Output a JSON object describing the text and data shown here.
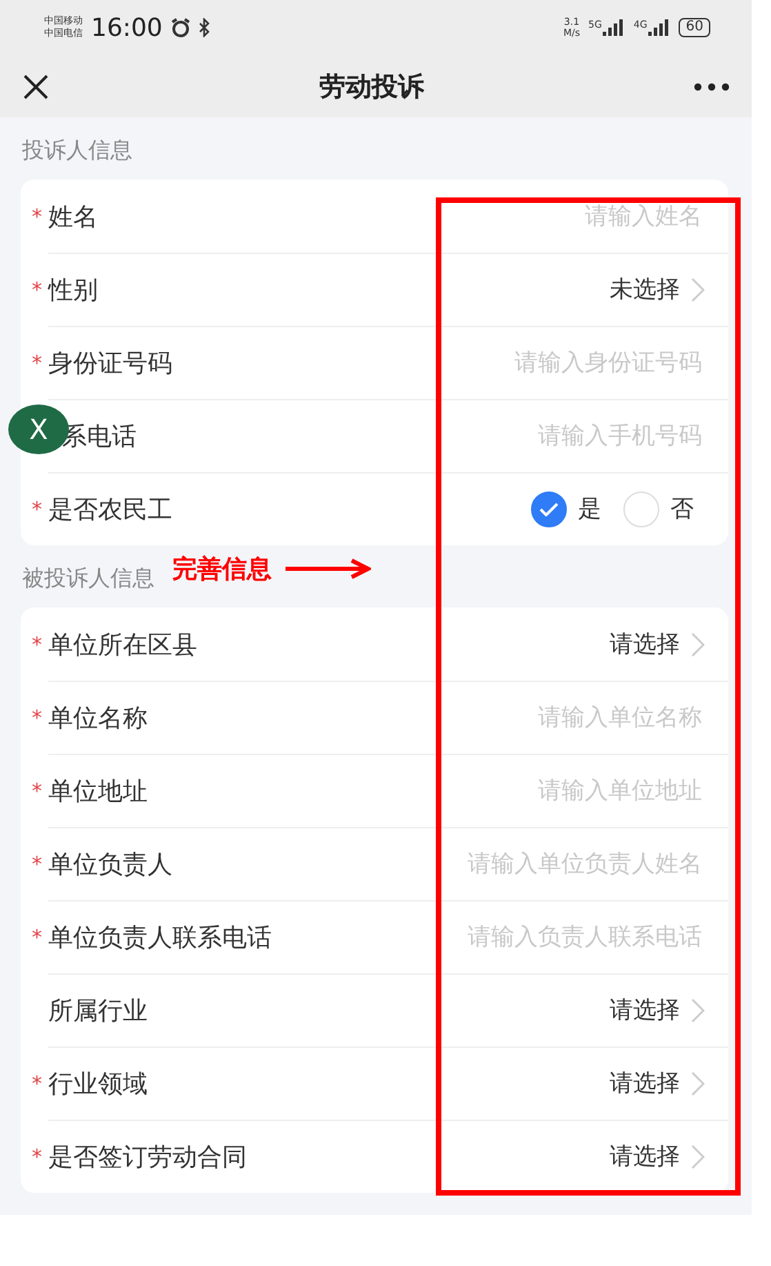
{
  "status_bar": {
    "carriers": [
      "中国移动",
      "中国电信"
    ],
    "time": "16:00",
    "speed": "3.1",
    "speed_unit": "M/s",
    "networks": [
      "5G",
      "4G"
    ],
    "battery": "60"
  },
  "nav": {
    "title": "劳动投诉"
  },
  "sections": [
    {
      "title": "投诉人信息",
      "rows": [
        {
          "kind": "input",
          "label": "姓名",
          "mark": "*",
          "placeholder": "请输入姓名"
        },
        {
          "kind": "select",
          "label": "性别",
          "mark": "*",
          "value": "未选择"
        },
        {
          "kind": "input",
          "label": "身份证号码",
          "mark": "*",
          "placeholder": "请输入身份证号码"
        },
        {
          "kind": "input",
          "label": "系电话",
          "placeholder": "请输入手机号码"
        },
        {
          "kind": "radio",
          "label": "是否农民工",
          "mark": "*",
          "options": [
            {
              "label": "是",
              "selected": true
            },
            {
              "label": "否",
              "selected": false
            }
          ]
        }
      ]
    },
    {
      "title": "被投诉人信息",
      "rows": [
        {
          "kind": "select",
          "label": "单位所在区县",
          "mark": "*",
          "value": "请选择"
        },
        {
          "kind": "input",
          "label": "单位名称",
          "mark": "*",
          "placeholder": "请输入单位名称"
        },
        {
          "kind": "input",
          "label": "单位地址",
          "mark": "*",
          "placeholder": "请输入单位地址"
        },
        {
          "kind": "input",
          "label": "单位负责人",
          "mark": "*",
          "placeholder": "请输入单位负责人姓名"
        },
        {
          "kind": "input",
          "label": "单位负责人联系电话",
          "mark": "*",
          "placeholder": "请输入负责人联系电话"
        },
        {
          "kind": "select",
          "label": "所属行业",
          "value": "请选择"
        },
        {
          "kind": "select",
          "label": "行业领域",
          "mark": "*",
          "value": "请选择"
        },
        {
          "kind": "select",
          "label": "是否签订劳动合同",
          "mark": "*",
          "value": "请选择"
        }
      ]
    }
  ],
  "floating_button": {
    "label": "X"
  },
  "annotation": {
    "label": "完善信息"
  }
}
